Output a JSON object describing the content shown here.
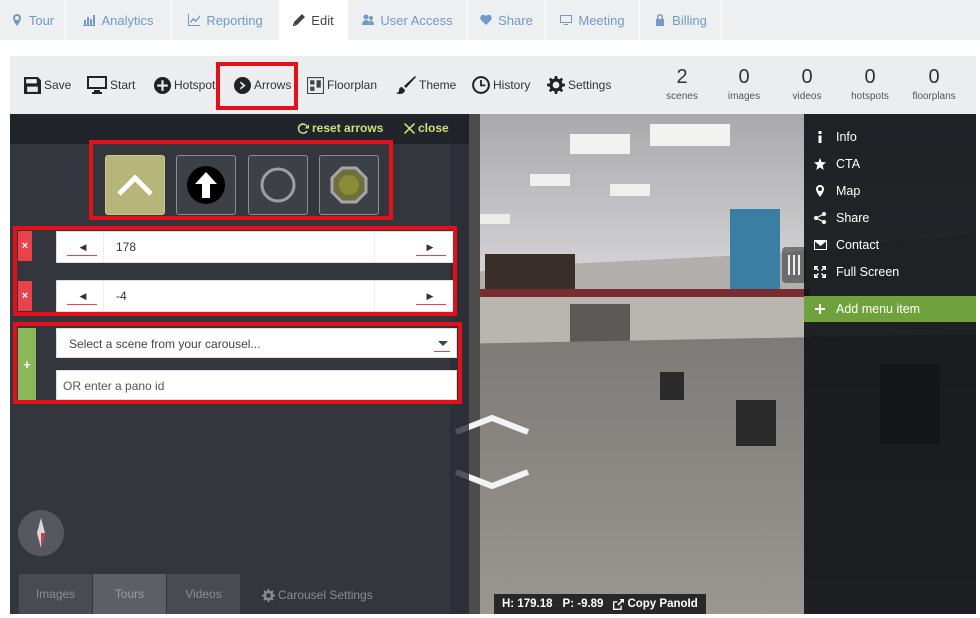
{
  "nav": {
    "tabs": [
      {
        "label": "Tour",
        "icon": "map-marker-icon",
        "active": false
      },
      {
        "label": "Analytics",
        "icon": "bar-chart-icon",
        "active": false
      },
      {
        "label": "Reporting",
        "icon": "line-chart-icon",
        "active": false
      },
      {
        "label": "Edit",
        "icon": "pencil-icon",
        "active": true
      },
      {
        "label": "User Access",
        "icon": "users-icon",
        "active": false
      },
      {
        "label": "Share",
        "icon": "heart-icon",
        "active": false
      },
      {
        "label": "Meeting",
        "icon": "monitor-icon",
        "active": false
      },
      {
        "label": "Billing",
        "icon": "lock-icon",
        "active": false
      }
    ]
  },
  "toolbar": {
    "save": "Save",
    "start": "Start",
    "hotspot": "Hotspot",
    "arrows": "Arrows",
    "floorplan": "Floorplan",
    "theme": "Theme",
    "history": "History",
    "settings": "Settings"
  },
  "stats": [
    {
      "value": "2",
      "label": "scenes"
    },
    {
      "value": "0",
      "label": "images"
    },
    {
      "value": "0",
      "label": "videos"
    },
    {
      "value": "0",
      "label": "hotspots"
    },
    {
      "value": "0",
      "label": "floorplans"
    }
  ],
  "arrow_panel": {
    "reset_label": "reset arrows",
    "close_label": "close",
    "styles": [
      "chevron-style",
      "arrow-circle-style",
      "ring-style",
      "octagon-style"
    ],
    "selected_style": "chevron-style",
    "heading_value": "178",
    "pitch_value": "-4",
    "remove_symbol": "×",
    "add_symbol": "+",
    "scene_select_placeholder": "Select a scene from your carousel...",
    "pano_id_placeholder": "OR enter a pano id"
  },
  "bottom_tabs": [
    "Images",
    "Tours",
    "Videos"
  ],
  "carousel_settings": "Carousel Settings",
  "menu": {
    "items": [
      {
        "label": "Info",
        "icon": "info-icon"
      },
      {
        "label": "CTA",
        "icon": "star-icon"
      },
      {
        "label": "Map",
        "icon": "map-marker-icon"
      },
      {
        "label": "Share",
        "icon": "share-icon"
      },
      {
        "label": "Contact",
        "icon": "envelope-icon"
      },
      {
        "label": "Full Screen",
        "icon": "expand-icon"
      }
    ],
    "add_item": "Add menu item"
  },
  "status": {
    "h_label": "H:",
    "h_value": "179.18",
    "p_label": "P:",
    "p_value": "-9.89",
    "copy_label": "Copy PanoId"
  },
  "colors": {
    "accent_link": "#6f9bc8",
    "highlight_red": "#e3101a",
    "add_green": "#6fa23d",
    "reset_yellow": "#d4de7a"
  }
}
